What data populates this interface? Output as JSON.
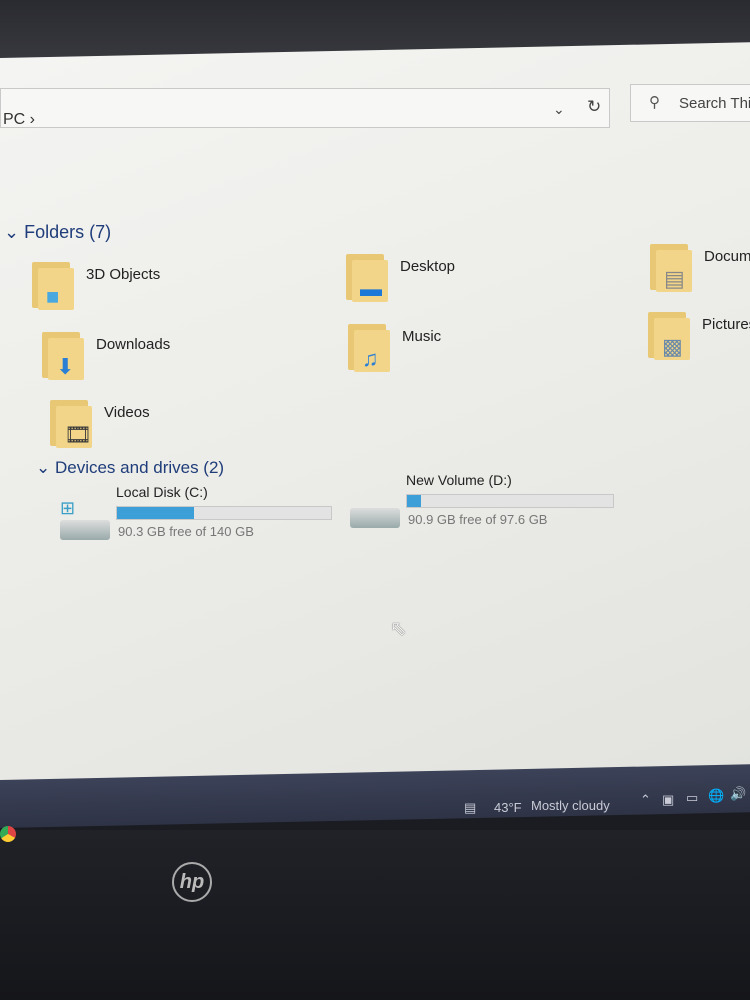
{
  "address": {
    "crumb": "PC  ›",
    "dropdown_icon": "chevron-down-icon",
    "refresh_icon": "refresh-icon"
  },
  "search": {
    "placeholder": "Search This"
  },
  "folders": {
    "header": "Folders (7)",
    "items": [
      {
        "label": "3D Objects",
        "icon": "3d-objects-folder-icon"
      },
      {
        "label": "Desktop",
        "icon": "desktop-folder-icon"
      },
      {
        "label": "Docum",
        "icon": "documents-folder-icon"
      },
      {
        "label": "Downloads",
        "icon": "downloads-folder-icon"
      },
      {
        "label": "Music",
        "icon": "music-folder-icon"
      },
      {
        "label": "Pictures",
        "icon": "pictures-folder-icon"
      },
      {
        "label": "Videos",
        "icon": "videos-folder-icon"
      }
    ]
  },
  "drives": {
    "header": "Devices and drives (2)",
    "items": [
      {
        "name": "Local Disk (C:)",
        "free": "90.3 GB free of 140 GB",
        "used_percent": 36
      },
      {
        "name": "New Volume (D:)",
        "free": "90.9 GB free of 97.6 GB",
        "used_percent": 7
      }
    ]
  },
  "taskbar": {
    "temperature": "43°F",
    "weather": "Mostly cloudy"
  },
  "colors": {
    "accent": "#3c9fd8",
    "group_header": "#1f3d7a"
  }
}
